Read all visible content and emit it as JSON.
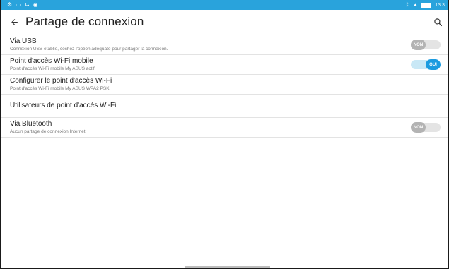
{
  "colors": {
    "status_bar": "#29a3dc",
    "toggle_on": "#1b9be0",
    "toggle_off": "#b3b3b3",
    "divider": "#e3e3e3"
  },
  "status_bar": {
    "time": "13:3",
    "left_icons": [
      "settings-icon",
      "message-icon",
      "usb-icon",
      "hotspot-icon"
    ],
    "right_icons": [
      "bluetooth-icon",
      "wifi-icon",
      "battery-icon"
    ]
  },
  "app_bar": {
    "title": "Partage de connexion",
    "back_icon": "arrow-left-icon",
    "search_icon": "search-icon"
  },
  "settings": [
    {
      "title": "Via USB",
      "subtitle": "Connexion USB établie, cochez l'option adéquate pour partager la connexion.",
      "toggle": {
        "state": "off",
        "label": "NON"
      }
    },
    {
      "title": "Point d'accès Wi-Fi mobile",
      "subtitle": "Point d'accès Wi-Fi mobile My ASUS actif",
      "toggle": {
        "state": "on",
        "label": "OUI"
      }
    },
    {
      "title": "Configurer le point d'accès Wi-Fi",
      "subtitle": "Point d'accès Wi-Fi mobile My ASUS WPA2 PSK"
    },
    {
      "title": "Utilisateurs de point d'accès Wi-Fi"
    },
    {
      "title": "Via Bluetooth",
      "subtitle": "Aucun partage de connexion Internet",
      "toggle": {
        "state": "off",
        "label": "NON"
      }
    }
  ]
}
